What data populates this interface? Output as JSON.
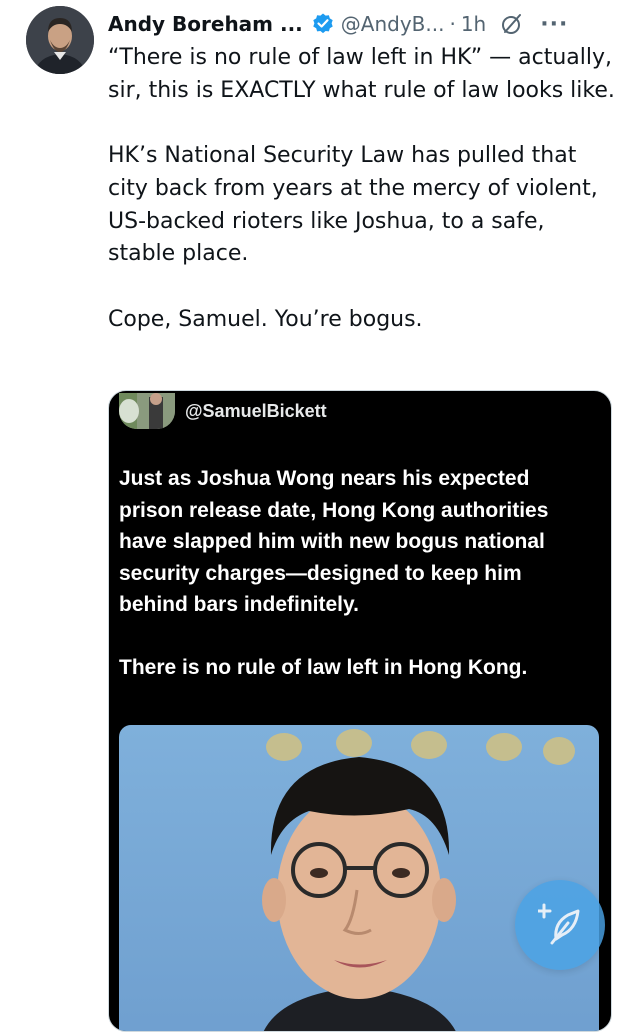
{
  "tweet": {
    "author_name": "Andy Boreham ...",
    "author_handle": "@AndyB...",
    "separator": "·",
    "timestamp": "1h",
    "more_label": "···",
    "text_paragraphs": [
      "“There is no rule of law left in HK” — actually, sir, this is EXACTLY what rule of law looks like.",
      "HK’s National Security Law has pulled that city back from years at the mercy of violent, US-backed rioters like Joshua, to a safe, stable place.",
      "Cope, Samuel. You’re bogus."
    ]
  },
  "quoted": {
    "handle": "@SamuelBickett",
    "paragraphs": [
      "Just as Joshua Wong nears his expected prison release date, Hong Kong authorities have slapped him with new bogus national security charges—designed to keep him behind bars indefinitely.",
      "There is no rule of law left in Hong Kong."
    ]
  },
  "icons": {
    "verified": "verified-badge-icon",
    "grok": "grok-icon",
    "compose": "compose-post-icon"
  },
  "colors": {
    "verified_blue": "#1d9bf0",
    "secondary_text": "#536471",
    "fab_blue": "#4aa3e6"
  }
}
